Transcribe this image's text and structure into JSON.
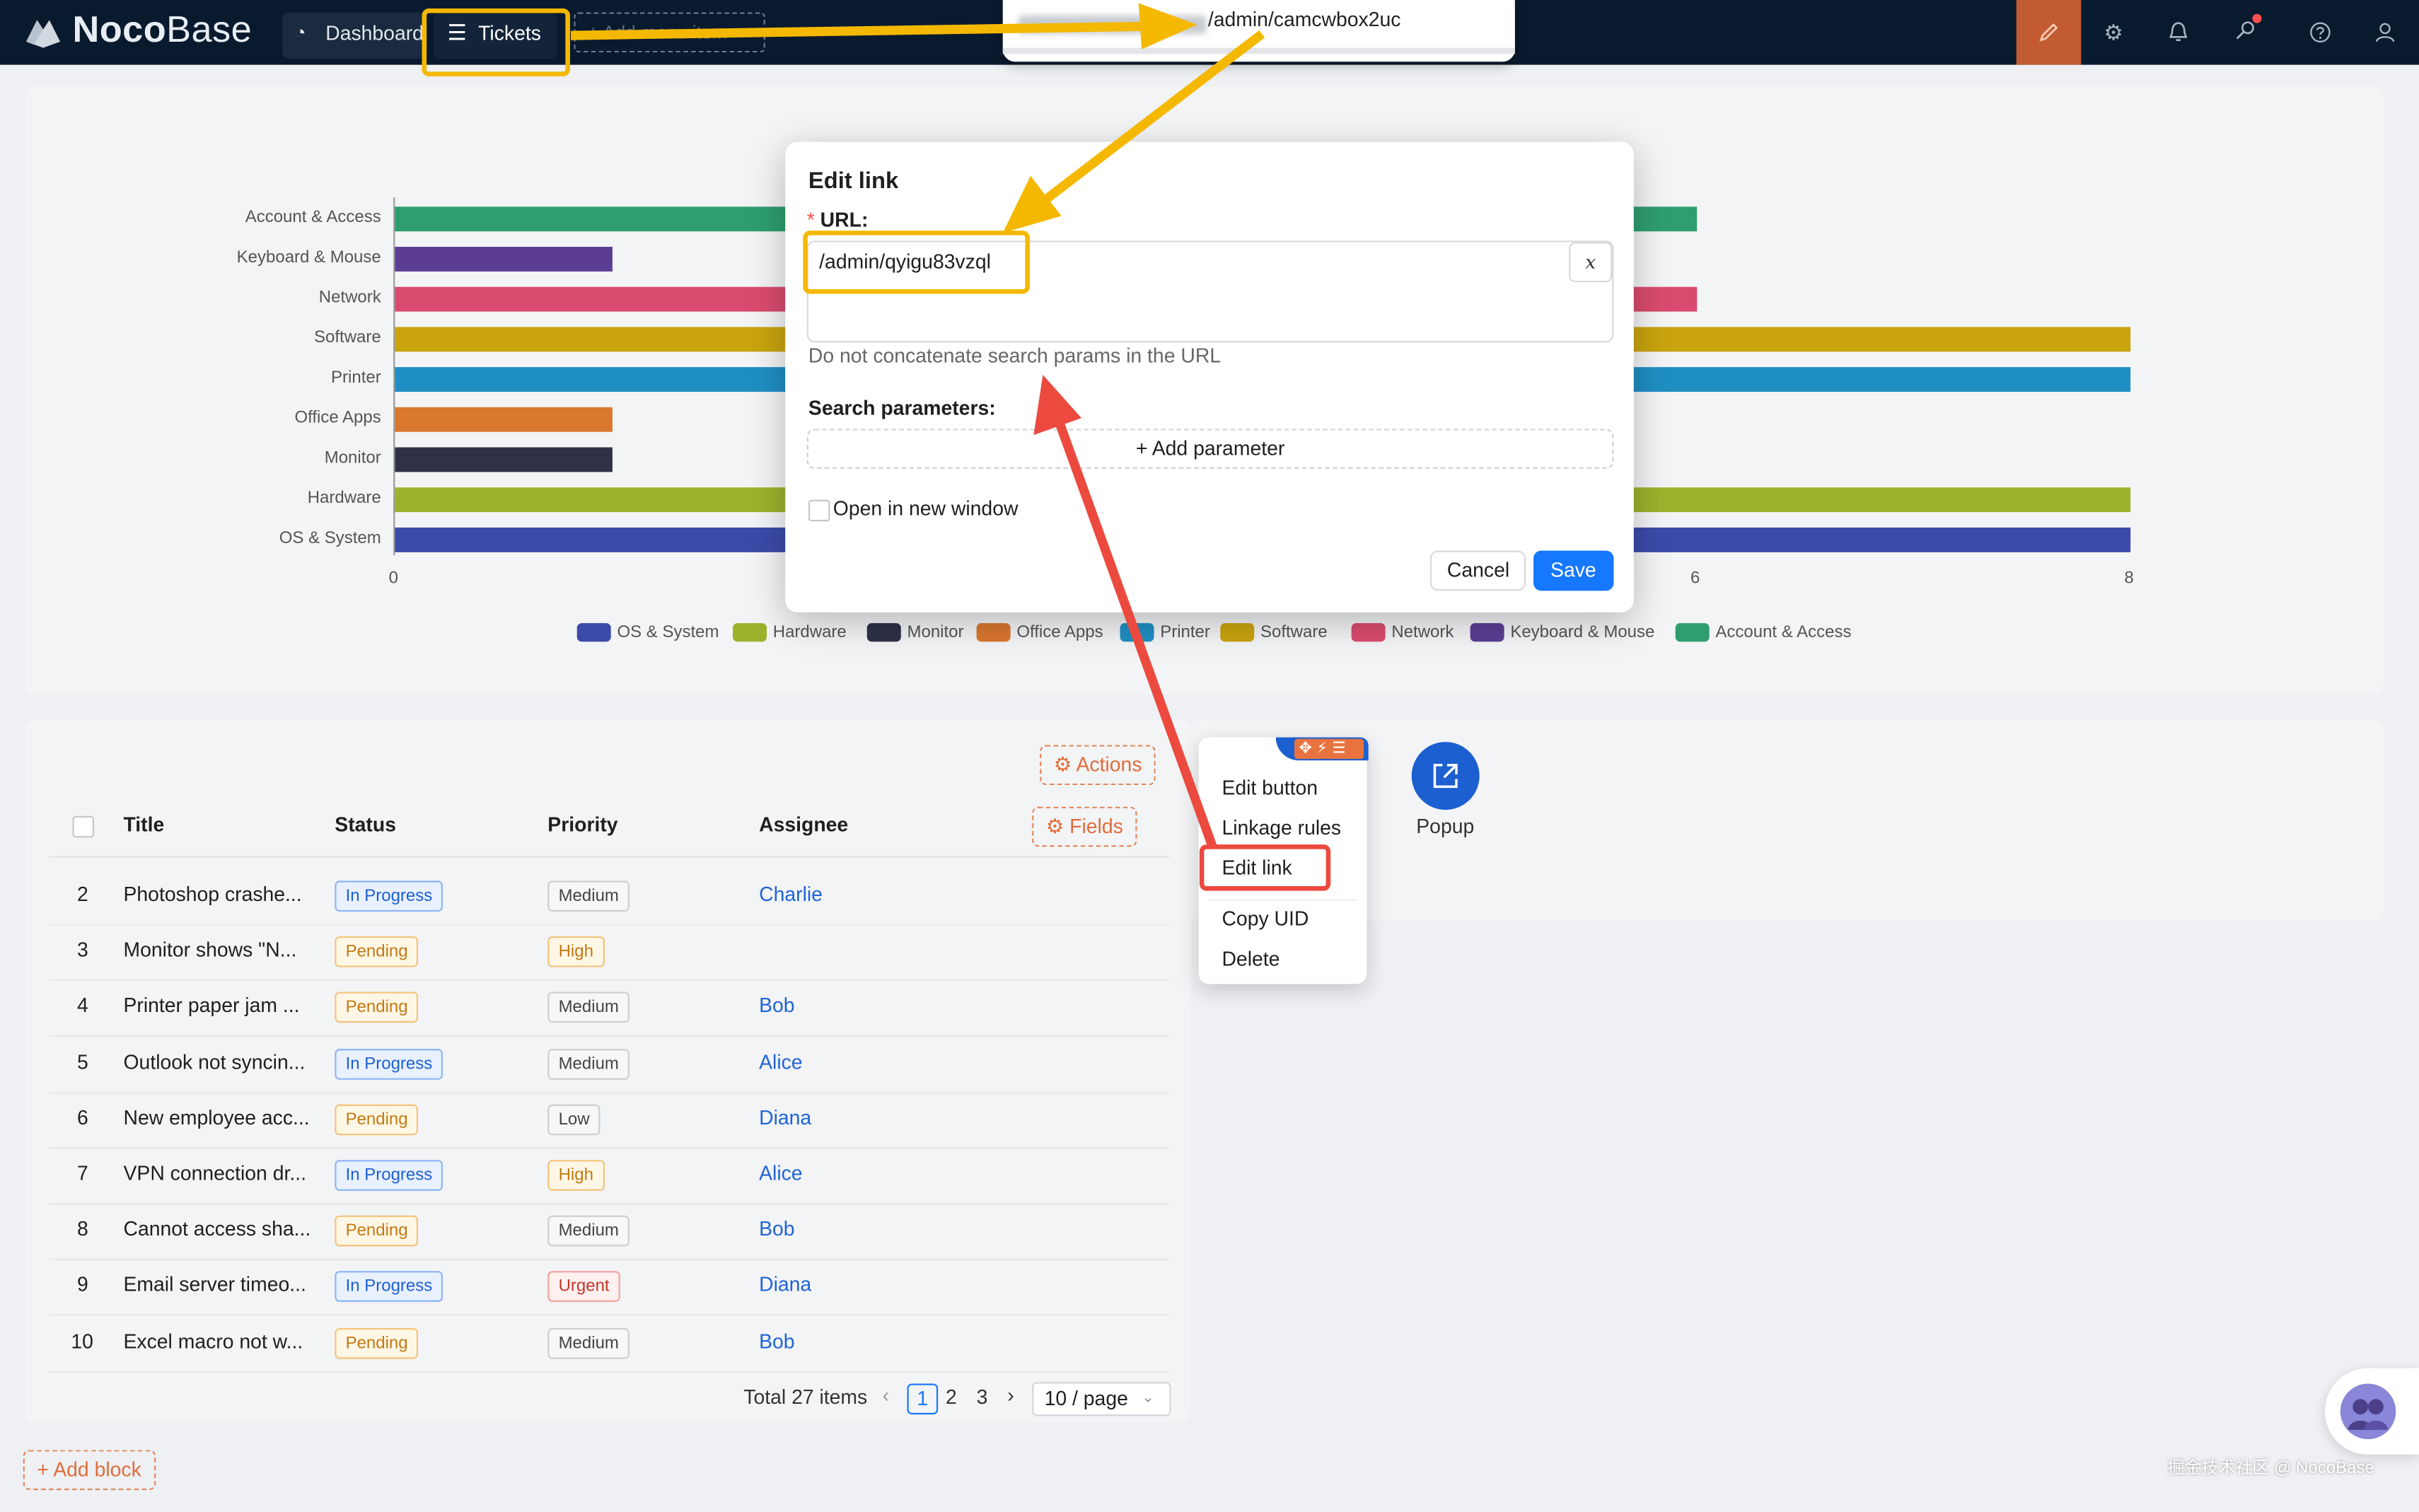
{
  "header": {
    "logo": {
      "bold": "Noco",
      "light": "Base"
    },
    "nav": [
      {
        "label": "Dashboard",
        "icon": "dashboard-icon"
      },
      {
        "label": "Tickets",
        "icon": "menu-icon"
      },
      {
        "label": "+ Add menu item"
      }
    ],
    "url_popup": "/admin/camcwbox2uc",
    "right_icons": [
      "ui-editor-icon",
      "gear-icon",
      "bell-icon",
      "key-icon",
      "help-icon",
      "user-icon"
    ]
  },
  "chart_data": {
    "type": "bar",
    "orientation": "horizontal",
    "categories": [
      "Account & Access",
      "Keyboard & Mouse",
      "Network",
      "Software",
      "Printer",
      "Office Apps",
      "Monitor",
      "Hardware",
      "OS & System"
    ],
    "values": [
      6,
      1,
      6,
      8,
      8,
      1,
      1,
      8,
      8
    ],
    "colors": [
      "#2f9e6f",
      "#5b3e94",
      "#d94b6e",
      "#c9a40f",
      "#1f8fc3",
      "#d9772e",
      "#2e3148",
      "#9bb32c",
      "#3b4ba8"
    ],
    "x_ticks": [
      "0",
      "6",
      "8"
    ],
    "xlim": [
      0,
      8
    ],
    "legend": [
      "OS & System",
      "Hardware",
      "Monitor",
      "Office Apps",
      "Printer",
      "Software",
      "Network",
      "Keyboard & Mouse",
      "Account & Access"
    ],
    "legend_position": "bottom"
  },
  "table": {
    "actions_label": "Actions",
    "fields_label": "Fields",
    "columns": [
      "Title",
      "Status",
      "Priority",
      "Assignee"
    ],
    "rows": [
      {
        "id": "2",
        "title": "Photoshop crashe...",
        "status": "In Progress",
        "priority": "Medium",
        "assignee": "Charlie"
      },
      {
        "id": "3",
        "title": "Monitor shows \"N...",
        "status": "Pending",
        "priority": "High",
        "assignee": ""
      },
      {
        "id": "4",
        "title": "Printer paper jam ...",
        "status": "Pending",
        "priority": "Medium",
        "assignee": "Bob"
      },
      {
        "id": "5",
        "title": "Outlook not syncin...",
        "status": "In Progress",
        "priority": "Medium",
        "assignee": "Alice"
      },
      {
        "id": "6",
        "title": "New employee acc...",
        "status": "Pending",
        "priority": "Low",
        "assignee": "Diana"
      },
      {
        "id": "7",
        "title": "VPN connection dr...",
        "status": "In Progress",
        "priority": "High",
        "assignee": "Alice"
      },
      {
        "id": "8",
        "title": "Cannot access sha...",
        "status": "Pending",
        "priority": "Medium",
        "assignee": "Bob"
      },
      {
        "id": "9",
        "title": "Email server timeo...",
        "status": "In Progress",
        "priority": "Urgent",
        "assignee": "Diana"
      },
      {
        "id": "10",
        "title": "Excel macro not w...",
        "status": "Pending",
        "priority": "Medium",
        "assignee": "Bob"
      }
    ],
    "pagination": {
      "total": "Total 27 items",
      "pages": [
        "1",
        "2",
        "3"
      ],
      "current": "1",
      "page_size": "10 / page"
    }
  },
  "popup_action": {
    "label": "Popup"
  },
  "context_menu": {
    "items": [
      "Edit button",
      "Linkage rules",
      "Edit link",
      "Copy UID",
      "Delete"
    ],
    "highlighted": "Edit link"
  },
  "modal": {
    "title": "Edit link",
    "url_label": "URL",
    "url_value": "/admin/qyigu83vzql",
    "variable_button": "x",
    "url_hint": "Do not concatenate search params in the URL",
    "search_params_label": "Search parameters",
    "add_param_label": "Add parameter",
    "open_new_window_label": "Open in new window",
    "open_new_window_checked": false,
    "cancel_label": "Cancel",
    "save_label": "Save"
  },
  "footer": {
    "add_block_label": "Add block",
    "watermark": "掘金技术社区 @ NocoBase"
  },
  "colors": {
    "header_bg": "#0a1a2e",
    "primary": "#1677ff",
    "annotation_yellow": "#f5b800",
    "annotation_red": "#ec4a3f",
    "design_orange": "#e06d3b"
  }
}
